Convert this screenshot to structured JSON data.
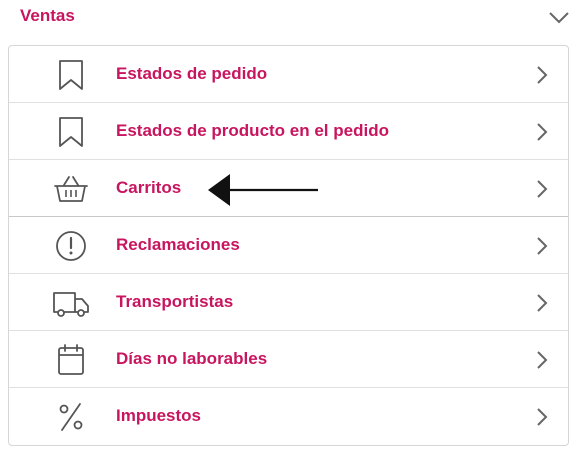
{
  "section": {
    "title": "Ventas"
  },
  "items": [
    {
      "label": "Estados de pedido",
      "icon": "bookmark-icon"
    },
    {
      "label": "Estados de producto en el pedido",
      "icon": "bookmark-icon"
    },
    {
      "label": "Carritos",
      "icon": "shopping-basket-icon"
    },
    {
      "label": "Reclamaciones",
      "icon": "alert-circle-icon"
    },
    {
      "label": "Transportistas",
      "icon": "truck-icon"
    },
    {
      "label": "Días no laborables",
      "icon": "calendar-icon"
    },
    {
      "label": "Impuestos",
      "icon": "percent-icon"
    }
  ],
  "colors": {
    "accent": "#c8155f",
    "icon": "#555555",
    "chevron": "#666666",
    "annotation_arrow": "#111111"
  }
}
